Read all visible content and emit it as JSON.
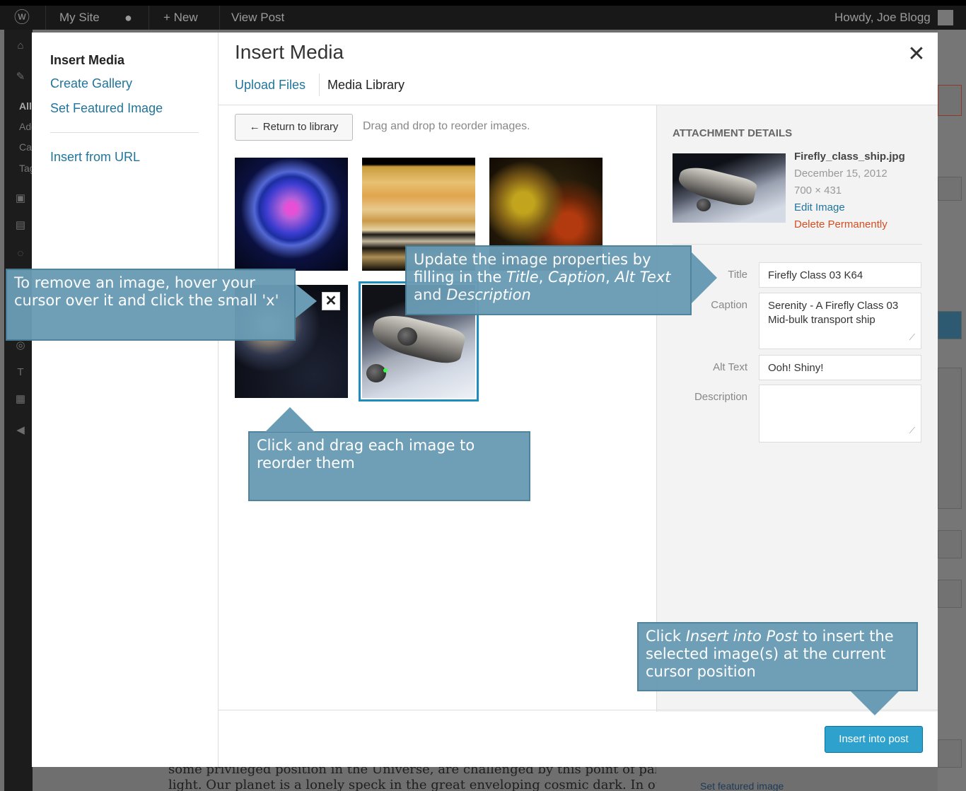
{
  "admin_bar": {
    "site_name": "My Site",
    "new_label": "+ New",
    "view_post": "View Post",
    "howdy": "Howdy, Joe Blogg"
  },
  "background": {
    "side_items": [
      "All",
      "Add",
      "Cat",
      "Tag"
    ],
    "text_line_1": "some privileged position in the Universe, are challenged by this point of pale",
    "text_line_2": "light. Our planet is a lonely speck in the great enveloping cosmic dark. In our",
    "set_featured_link": "Set featured image"
  },
  "modal": {
    "title": "Insert Media",
    "close_symbol": "✕",
    "menu": {
      "insert_media": "Insert Media",
      "create_gallery": "Create Gallery",
      "set_featured_image": "Set Featured Image",
      "insert_from_url": "Insert from URL"
    },
    "tabs": {
      "upload": "Upload Files",
      "library": "Media Library"
    },
    "toolbar": {
      "return_label": "← Return to library",
      "drag_hint": "Drag and drop to reorder images."
    },
    "remove_symbol": "✕",
    "attachment": {
      "heading": "ATTACHMENT DETAILS",
      "filename": "Firefly_class_ship.jpg",
      "date": "December 15, 2012",
      "dimensions": "700 × 431",
      "edit_link": "Edit Image",
      "delete_link": "Delete Permanently",
      "fields": {
        "title_label": "Title",
        "title_value": "Firefly Class 03 K64",
        "caption_label": "Caption",
        "caption_value": "Serenity - A Firefly Class 03 Mid-bulk transport ship",
        "alt_label": "Alt Text",
        "alt_value": "Ooh! Shiny!",
        "description_label": "Description",
        "description_value": ""
      }
    },
    "insert_button": "Insert into post"
  },
  "callouts": {
    "remove": "To remove an image, hover your cursor over it and click the small 'x'",
    "update_prefix": "Update the image properties by filling in the ",
    "update_title": "Title",
    "update_sep1": ", ",
    "update_caption": "Caption",
    "update_sep2": ", ",
    "update_alt": "Alt Text",
    "update_and": " and ",
    "update_desc": "Description",
    "drag": "Click and drag each image to reorder them",
    "insert_prefix": "Click ",
    "insert_em": "Insert into Post",
    "insert_suffix": " to insert the selected image(s) at the current cursor position"
  },
  "colors": {
    "link": "#21759b",
    "delete": "#d54e21",
    "primary_button": "#2ea2cc",
    "callout": "#6a9cb5",
    "selected_border": "#1e8cbe"
  }
}
